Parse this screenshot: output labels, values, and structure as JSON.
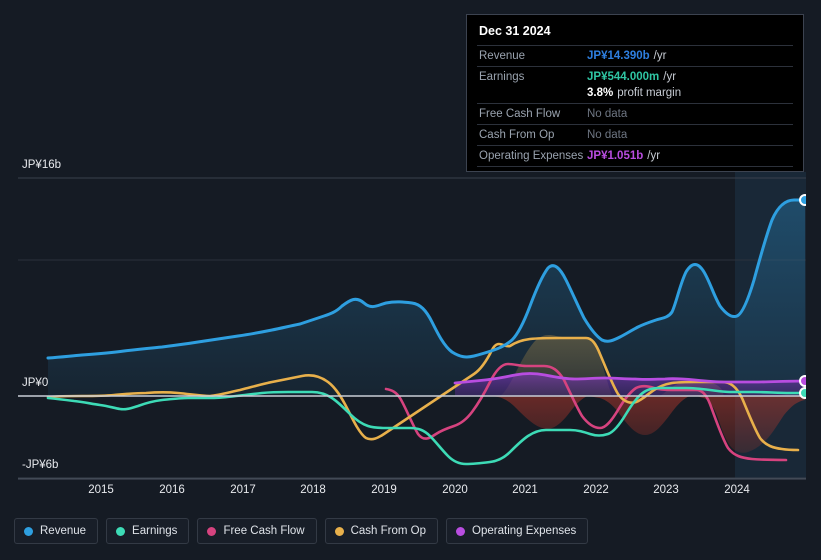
{
  "tooltip": {
    "date": "Dec 31 2024",
    "rows": [
      {
        "label": "Revenue",
        "value": "JP¥14.390b",
        "unit": "/yr",
        "color_key": "c-rev",
        "nodata": false
      },
      {
        "label": "Earnings",
        "value": "JP¥544.000m",
        "unit": "/yr",
        "color_key": "c-ear",
        "nodata": false
      },
      {
        "label": "",
        "value": "3.8%",
        "unit": "profit margin",
        "color_key": "c-pm",
        "nodata": false
      },
      {
        "label": "Free Cash Flow",
        "value": "No data",
        "unit": "",
        "color_key": "nodata",
        "nodata": true
      },
      {
        "label": "Cash From Op",
        "value": "No data",
        "unit": "",
        "color_key": "nodata",
        "nodata": true
      },
      {
        "label": "Operating Expenses",
        "value": "JP¥1.051b",
        "unit": "/yr",
        "color_key": "c-opex",
        "nodata": false
      }
    ],
    "r0_label": "Revenue",
    "r0_value": "JP¥14.390b",
    "r0_unit": "/yr",
    "r1_label": "Earnings",
    "r1_value": "JP¥544.000m",
    "r1_unit": "/yr",
    "r2_value": "3.8%",
    "r2_unit": "profit margin",
    "r3_label": "Free Cash Flow",
    "r3_value": "No data",
    "r4_label": "Cash From Op",
    "r4_value": "No data",
    "r5_label": "Operating Expenses",
    "r5_value": "JP¥1.051b",
    "r5_unit": "/yr"
  },
  "axes": {
    "y_top": "JP¥16b",
    "y_zero": "JP¥0",
    "y_bottom": "-JP¥6b",
    "x": [
      "2015",
      "2016",
      "2017",
      "2018",
      "2019",
      "2020",
      "2021",
      "2022",
      "2023",
      "2024"
    ]
  },
  "legend": {
    "items": [
      {
        "label": "Revenue",
        "color": "#2e9fe0"
      },
      {
        "label": "Earnings",
        "color": "#3ddbb6"
      },
      {
        "label": "Free Cash Flow",
        "color": "#d6437f"
      },
      {
        "label": "Cash From Op",
        "color": "#e8b04b"
      },
      {
        "label": "Operating Expenses",
        "color": "#b84de0"
      }
    ],
    "i0": "Revenue",
    "i1": "Earnings",
    "i2": "Free Cash Flow",
    "i3": "Cash From Op",
    "i4": "Operating Expenses"
  },
  "chart_data": {
    "type": "line",
    "title": "",
    "xlabel": "",
    "ylabel": "JP¥",
    "currency": "JP¥",
    "ylim": [
      -6,
      16
    ],
    "y_ticks": [
      16,
      10,
      0,
      -6
    ],
    "y_tick_labels": [
      "JP¥16b",
      "",
      "JP¥0",
      "-JP¥6b"
    ],
    "grid": true,
    "legend_position": "bottom",
    "x_range": [
      "2014-06",
      "2024-12"
    ],
    "x_tick_labels": [
      "2015",
      "2016",
      "2017",
      "2018",
      "2019",
      "2020",
      "2021",
      "2022",
      "2023",
      "2024"
    ],
    "highlight_band": {
      "from": "2023-10",
      "to": "2024-12",
      "note": "latest period shading"
    },
    "series": [
      {
        "name": "Revenue",
        "color": "#2e9fe0",
        "end_label": "JP¥14.390b",
        "x": [
          "2014-06",
          "2014-12",
          "2015-06",
          "2015-12",
          "2016-06",
          "2016-12",
          "2017-06",
          "2017-12",
          "2018-06",
          "2018-12",
          "2019-06",
          "2019-12",
          "2020-06",
          "2020-12",
          "2021-06",
          "2021-12",
          "2022-06",
          "2022-12",
          "2023-03",
          "2023-06",
          "2023-09",
          "2023-12",
          "2024-03",
          "2024-06",
          "2024-09",
          "2024-12"
        ],
        "values": [
          2.8,
          2.9,
          2.9,
          3.0,
          3.1,
          3.3,
          3.4,
          3.5,
          4.2,
          5.6,
          6.8,
          6.8,
          6.6,
          4.0,
          3.2,
          5.2,
          9.5,
          7.3,
          6.6,
          6.5,
          7.2,
          8.8,
          8.2,
          11.6,
          9.2,
          14.39
        ]
      },
      {
        "name": "Earnings",
        "color": "#3ddbb6",
        "end_label": "JP¥544.000m",
        "x": [
          "2014-06",
          "2014-12",
          "2015-06",
          "2015-12",
          "2016-06",
          "2016-12",
          "2017-06",
          "2017-12",
          "2018-06",
          "2018-12",
          "2019-06",
          "2019-12",
          "2020-06",
          "2020-12",
          "2021-06",
          "2021-12",
          "2022-06",
          "2022-12",
          "2023-03",
          "2023-06",
          "2023-09",
          "2023-12",
          "2024-03",
          "2024-06",
          "2024-09",
          "2024-12"
        ],
        "values": [
          -0.15,
          -0.2,
          -0.35,
          -0.4,
          -0.2,
          -0.15,
          -0.1,
          0.1,
          0.25,
          0.25,
          0.1,
          -0.5,
          -1.6,
          -3.5,
          -3.8,
          -2.2,
          -2.1,
          -2.4,
          -1.5,
          -0.2,
          0.3,
          0.45,
          0.1,
          0.35,
          0.45,
          0.544
        ]
      },
      {
        "name": "Free Cash Flow",
        "color": "#d6437f",
        "end_label": "No data",
        "x": [
          "2018-06",
          "2018-12",
          "2019-06",
          "2019-12",
          "2020-06",
          "2020-12",
          "2021-06",
          "2021-12",
          "2022-06",
          "2022-12",
          "2023-03",
          "2023-06",
          "2023-09",
          "2023-12",
          "2024-03",
          "2024-06"
        ],
        "values": [
          0.55,
          0.4,
          -0.9,
          -3.1,
          -2.5,
          -1.0,
          1.9,
          2.2,
          -0.5,
          -2.6,
          -1.4,
          0.55,
          0.6,
          0.55,
          -3.2,
          -4.5
        ]
      },
      {
        "name": "Cash From Op",
        "color": "#e8b04b",
        "end_label": "No data",
        "x": [
          "2014-06",
          "2014-12",
          "2015-06",
          "2015-12",
          "2016-06",
          "2016-12",
          "2017-06",
          "2017-12",
          "2018-06",
          "2018-12",
          "2019-06",
          "2019-12",
          "2020-06",
          "2020-12",
          "2021-06",
          "2021-12",
          "2022-06",
          "2022-12",
          "2023-03",
          "2023-06",
          "2023-09",
          "2023-12",
          "2024-03",
          "2024-06"
        ],
        "values": [
          0.0,
          0.05,
          0.0,
          0.1,
          0.15,
          0.2,
          0.1,
          0.45,
          0.95,
          0.75,
          -0.6,
          -2.9,
          -2.2,
          -0.4,
          2.6,
          2.9,
          -0.1,
          -2.3,
          -1.1,
          0.85,
          0.9,
          0.85,
          -2.6,
          -3.6
        ]
      },
      {
        "name": "Operating Expenses",
        "color": "#b84de0",
        "end_label": "JP¥1.051b",
        "x": [
          "2020-03",
          "2020-06",
          "2020-12",
          "2021-06",
          "2021-12",
          "2022-06",
          "2022-12",
          "2023-06",
          "2023-12",
          "2024-06",
          "2024-12"
        ],
        "values": [
          0.95,
          0.95,
          1.1,
          1.25,
          1.2,
          1.0,
          1.15,
          1.2,
          1.1,
          1.05,
          1.051
        ]
      }
    ]
  }
}
